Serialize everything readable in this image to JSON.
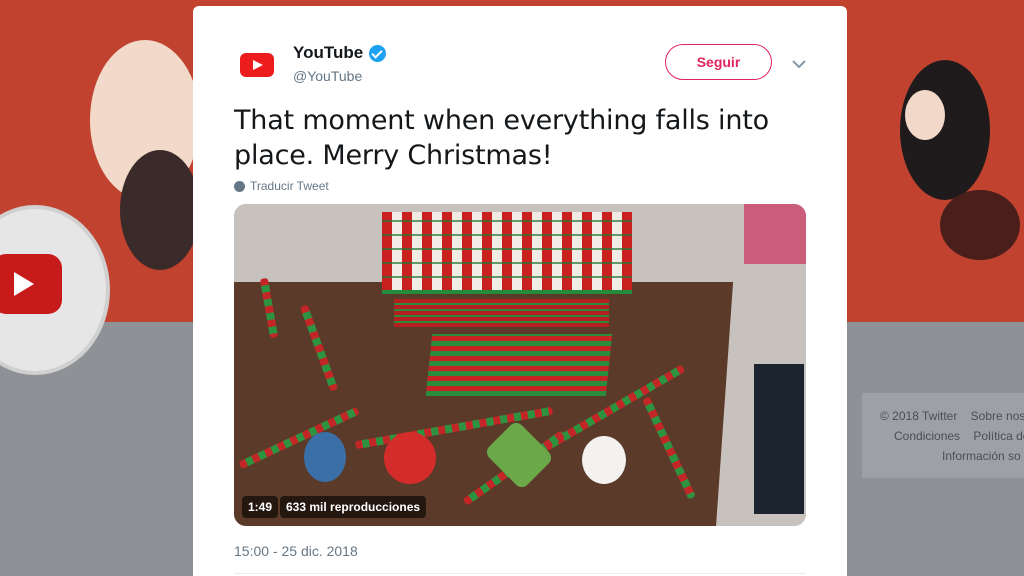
{
  "tweet": {
    "author_name": "YouTube",
    "author_handle": "@YouTube",
    "follow_label": "Seguir",
    "text": "That moment when everything falls into place. Merry Christmas!",
    "translate_label": "Traducir Tweet",
    "timestamp": "15:00 - 25 dic. 2018",
    "video": {
      "duration": "1:49",
      "views": "633 mil reproducciones"
    }
  },
  "sidebar_footer": {
    "links_row1": [
      "© 2018 Twitter",
      "Sobre nos"
    ],
    "links_row2": [
      "Condiciones",
      "Política de"
    ],
    "links_row3": [
      "Información so"
    ]
  },
  "colors": {
    "follow_accent": "#e0245e",
    "verified": "#1da1f2",
    "youtube_red": "#ee1d1d",
    "banner": "#c1432f"
  },
  "icons": [
    "youtube-logo-icon",
    "verified-badge-icon",
    "chevron-down-icon",
    "globe-icon"
  ]
}
